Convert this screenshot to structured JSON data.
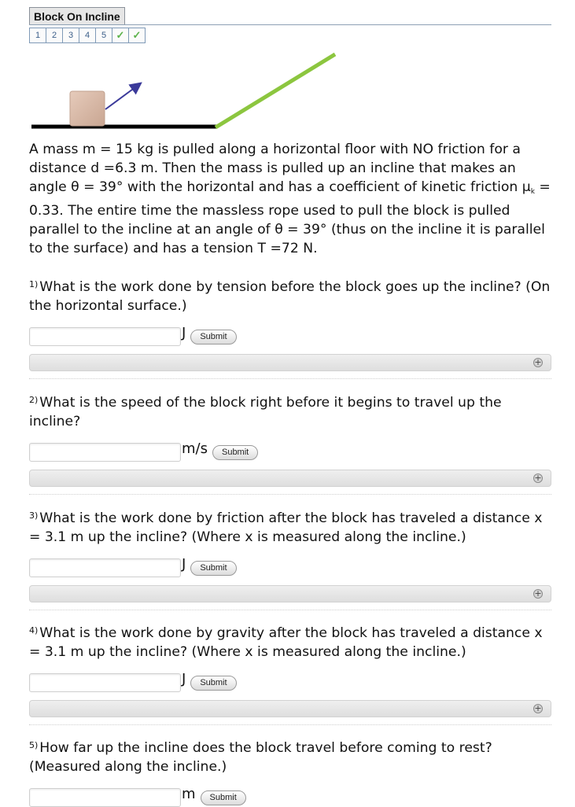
{
  "header": {
    "title": "Block On Incline"
  },
  "parts_nav": [
    {
      "label": "1",
      "status": "open"
    },
    {
      "label": "2",
      "status": "open"
    },
    {
      "label": "3",
      "status": "open"
    },
    {
      "label": "4",
      "status": "open"
    },
    {
      "label": "5",
      "status": "open"
    },
    {
      "label": "✓",
      "status": "done"
    },
    {
      "label": "✓",
      "status": "done"
    }
  ],
  "diagram": {
    "floor_color": "#000000",
    "incline_color": "#8cc63f",
    "block_color": "#d9b8a4",
    "arrow_color": "#3b3a9a"
  },
  "problem": {
    "part1": "A mass m = 15 kg is pulled along a horizontal floor with NO friction for a distance d =6.3 m. Then the mass is pulled up an incline that makes an angle θ = 39° with the horizontal and has a coefficient of kinetic friction μ",
    "mu_sub": "k",
    "part2": " = 0.33. The entire time the massless rope used to pull the block is pulled parallel to the incline at an angle of θ = 39° (thus on the incline it is parallel to the surface) and has a tension T =72 N."
  },
  "questions": [
    {
      "num": "1)",
      "text": "What is the work done by tension before the block goes up the incline? (On the horizontal surface.)",
      "unit": "J",
      "value": "",
      "submit": "Submit"
    },
    {
      "num": "2)",
      "text": "What is the speed of the block right before it begins to travel up the incline?",
      "unit": "m/s",
      "value": "",
      "submit": "Submit"
    },
    {
      "num": "3)",
      "text": "What is the work done by friction after the block has traveled a distance x = 3.1 m up the incline? (Where x is measured along the incline.)",
      "unit": "J",
      "value": "",
      "submit": "Submit"
    },
    {
      "num": "4)",
      "text": "What is the work done by gravity after the block has traveled a distance x = 3.1 m up the incline? (Where x is measured along the incline.)",
      "unit": "J",
      "value": "",
      "submit": "Submit"
    },
    {
      "num": "5)",
      "text": "How far up the incline does the block travel before coming to rest? (Measured along the incline.)",
      "unit": "m",
      "value": "",
      "submit": "Submit"
    }
  ],
  "icons": {
    "expand": "plus-circle-icon",
    "done": "checkmark-icon"
  }
}
